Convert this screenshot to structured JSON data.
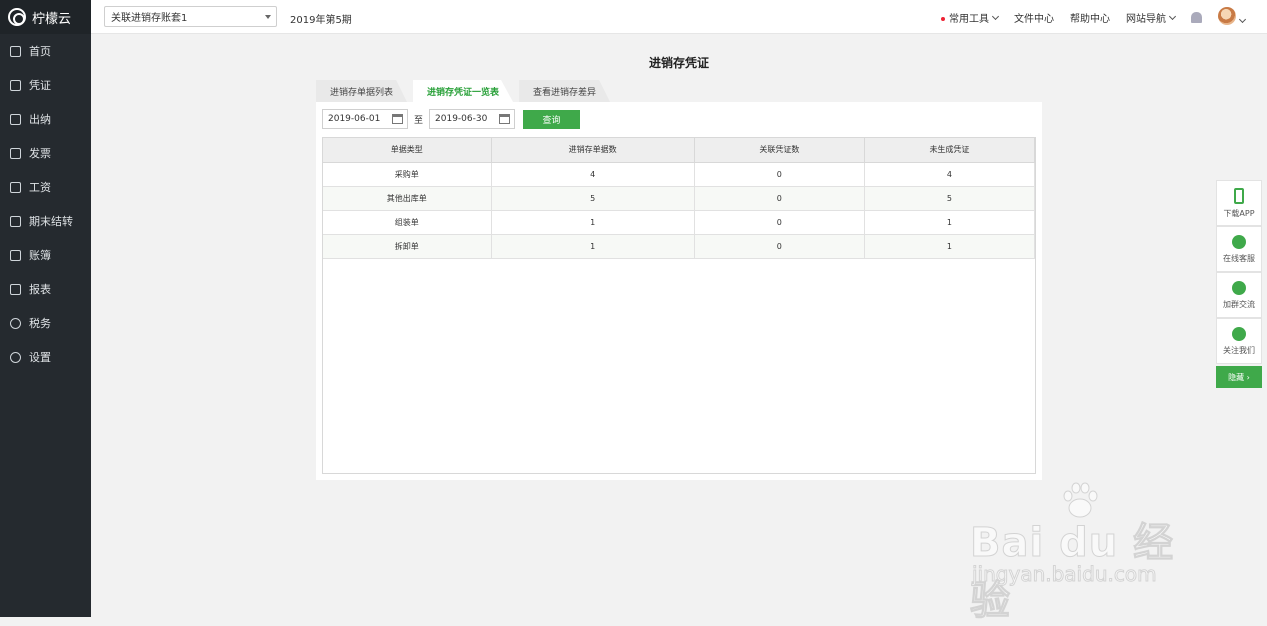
{
  "brand": {
    "name": "柠檬云"
  },
  "sidebar": {
    "items": [
      {
        "label": "首页",
        "icon": "home-icon"
      },
      {
        "label": "凭证",
        "icon": "voucher-icon"
      },
      {
        "label": "出纳",
        "icon": "cashier-icon"
      },
      {
        "label": "发票",
        "icon": "invoice-icon"
      },
      {
        "label": "工资",
        "icon": "salary-icon"
      },
      {
        "label": "期末结转",
        "icon": "calendar-icon"
      },
      {
        "label": "账簿",
        "icon": "book-icon"
      },
      {
        "label": "报表",
        "icon": "chart-icon"
      },
      {
        "label": "税务",
        "icon": "tax-icon"
      },
      {
        "label": "设置",
        "icon": "gear-icon"
      }
    ]
  },
  "topbar": {
    "book_selected": "关联进销存账套1",
    "period": "2019年第5期",
    "links": {
      "tools": "常用工具",
      "files": "文件中心",
      "help": "帮助中心",
      "nav": "网站导航"
    }
  },
  "main": {
    "title": "进销存凭证",
    "tabs": [
      "进销存单据列表",
      "进销存凭证一览表",
      "查看进销存差异"
    ],
    "active_tab": 1,
    "filter": {
      "start": "2019-06-01",
      "to": "至",
      "end": "2019-06-30",
      "query": "查询"
    },
    "table": {
      "headers": [
        "单据类型",
        "进销存单据数",
        "关联凭证数",
        "未生成凭证"
      ],
      "rows": [
        [
          "采购单",
          "4",
          "0",
          "4"
        ],
        [
          "其他出库单",
          "5",
          "0",
          "5"
        ],
        [
          "组装单",
          "1",
          "0",
          "1"
        ],
        [
          "拆卸单",
          "1",
          "0",
          "1"
        ]
      ]
    }
  },
  "float_bar": {
    "items": [
      "下载APP",
      "在线客服",
      "加群交流",
      "关注我们"
    ],
    "hide": "隐藏 ›"
  },
  "watermark": {
    "main": "Bai du 经验",
    "sub": "jingyan.baidu.com"
  },
  "colors": {
    "accent": "#3fa94a",
    "sidebar": "#252a2f"
  }
}
